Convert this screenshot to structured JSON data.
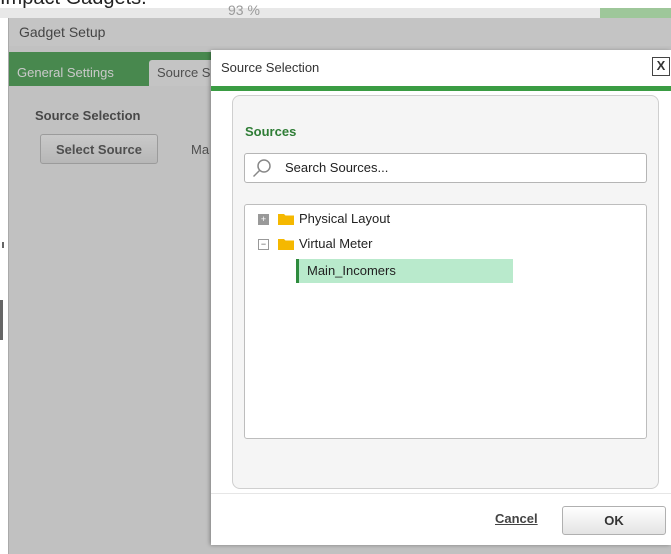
{
  "background": {
    "caption": "Impact Gadgets.",
    "percent_label": "93 %"
  },
  "gadget": {
    "title": "Gadget Setup",
    "tabs": [
      {
        "label": "General Settings"
      },
      {
        "label": "Source Selection"
      }
    ],
    "section_heading": "Source Selection",
    "select_source_label": "Select Source",
    "selected_source_prefix": "Ma"
  },
  "dialog": {
    "title": "Source Selection",
    "close_label": "X",
    "sources_label": "Sources",
    "search_placeholder": "Search Sources...",
    "tree": [
      {
        "label": "Physical Layout",
        "expander": "+",
        "expanded": false,
        "icon": "folder-icon"
      },
      {
        "label": "Virtual Meter",
        "expander": "−",
        "expanded": true,
        "icon": "folder-icon"
      }
    ],
    "selected_item": "Main_Incomers",
    "cancel_label": "Cancel",
    "ok_label": "OK"
  },
  "colors": {
    "accent_green": "#3a9c43",
    "selection_bg": "#b9eacc",
    "folder_yellow": "#f5b800"
  }
}
